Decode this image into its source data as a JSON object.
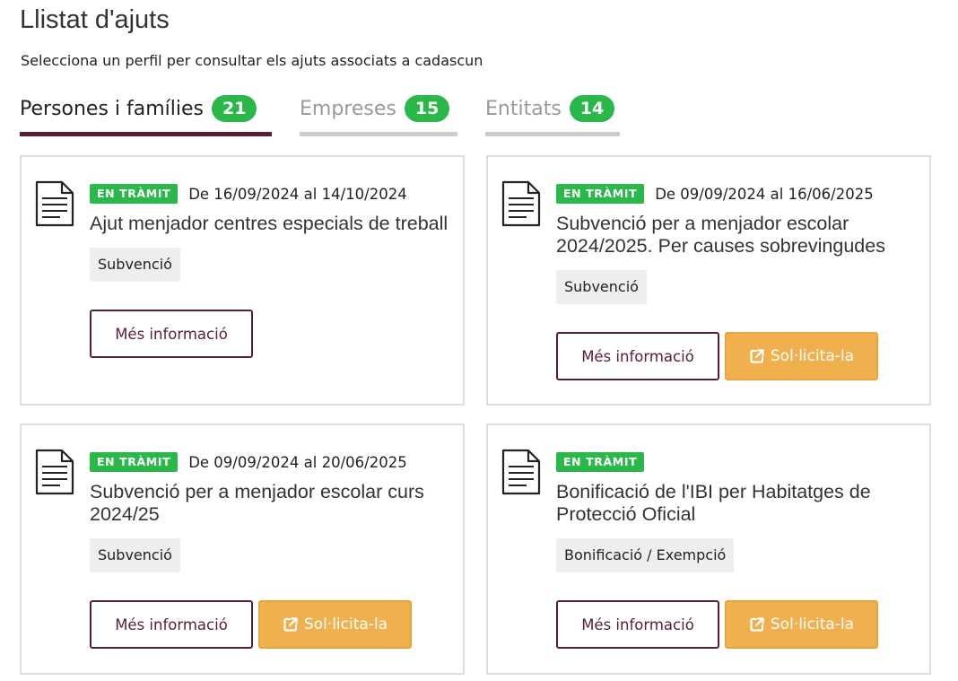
{
  "header": {
    "title": "Llistat d'ajuts",
    "subtitle": "Selecciona un perfil per consultar els ajuts associats a cadascun"
  },
  "tabs": [
    {
      "label": "Persones i famílies",
      "count": "21",
      "active": true
    },
    {
      "label": "Empreses",
      "count": "15",
      "active": false
    },
    {
      "label": "Entitats",
      "count": "14",
      "active": false
    }
  ],
  "cards": [
    {
      "status": "EN TRÀMIT",
      "dates": "De 16/09/2024 al 14/10/2024",
      "title": "Ajut menjador centres especials de treball",
      "type": "Subvenció",
      "info_label": "Més informació",
      "apply_label": ""
    },
    {
      "status": "EN TRÀMIT",
      "dates": "De 09/09/2024 al 16/06/2025",
      "title": "Subvenció per a menjador escolar 2024/2025. Per causes sobrevingudes",
      "type": "Subvenció",
      "info_label": "Més informació",
      "apply_label": "Sol·licita-la"
    },
    {
      "status": "EN TRÀMIT",
      "dates": "De 09/09/2024 al 20/06/2025",
      "title": "Subvenció per a menjador escolar curs 2024/25",
      "type": "Subvenció",
      "info_label": "Més informació",
      "apply_label": "Sol·licita-la"
    },
    {
      "status": "EN TRÀMIT",
      "dates": "",
      "title": "Bonificació de l'IBI per Habitatges de Protecció Oficial",
      "type": "Bonificació / Exempció",
      "info_label": "Més informació",
      "apply_label": "Sol·licita-la"
    }
  ],
  "icons": {
    "card_icon": "document-icon",
    "apply_icon": "external-link-icon"
  },
  "colors": {
    "accent": "#5a1e32",
    "status_green": "#2bb84a",
    "apply_orange": "#f0b04e",
    "tag_bg": "#eeeeee"
  }
}
